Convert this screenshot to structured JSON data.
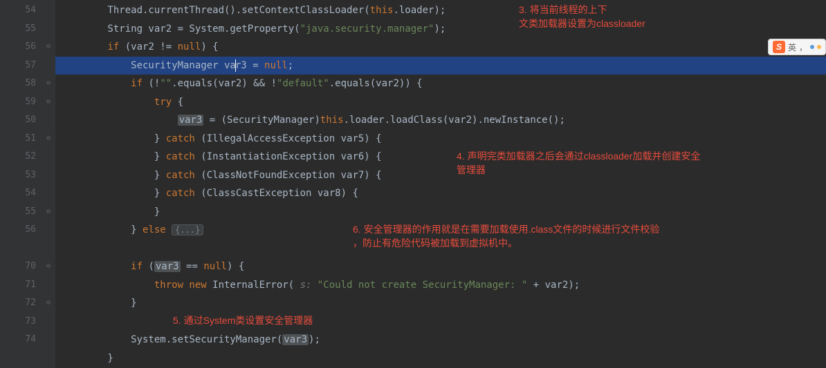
{
  "lineNumbers": [
    "54",
    "55",
    "56",
    "57",
    "58",
    "59",
    "50",
    "51",
    "52",
    "53",
    "54",
    "55",
    "56",
    "",
    "70",
    "71",
    "72",
    "73",
    "74"
  ],
  "foldMarks": [
    "",
    "",
    "⊖",
    "",
    "⊖",
    "⊖",
    "",
    "⊖",
    "",
    "",
    "",
    "⊖",
    "",
    "",
    "⊖",
    "",
    "⊖",
    "",
    ""
  ],
  "code": {
    "l54_pre": "        Thread.currentThread().setContextClassLoader(",
    "l54_this": "this",
    "l54_post": ".loader);",
    "l55_pre": "        String var2 = System.getProperty(",
    "l55_str": "\"java.security.manager\"",
    "l55_post": ");",
    "l56_if": "        if",
    "l56_cond": " (var2 != ",
    "l56_null": "null",
    "l56_post": ") {",
    "l57_pre": "            SecurityManager va",
    "l57_r3": "r3 = ",
    "l57_null": "null",
    "l57_post": ";",
    "l58_if": "            if",
    "l58_p1": " (!",
    "l58_s1": "\"\"",
    "l58_p2": ".equals(var2) && !",
    "l58_s2": "\"default\"",
    "l58_p3": ".equals(var2)) {",
    "l59_try": "                try",
    "l59_post": " {",
    "l60_pre": "                    ",
    "l60_var3": "var3",
    "l60_p1": " = (SecurityManager)",
    "l60_this": "this",
    "l60_p2": ".loader.loadClass(var2).newInstance();",
    "l61_pre": "                } ",
    "l61_catch": "catch",
    "l61_post": " (IllegalAccessException var5) {",
    "l62_pre": "                } ",
    "l62_catch": "catch",
    "l62_post": " (InstantiationException var6) {",
    "l63_pre": "                } ",
    "l63_catch": "catch",
    "l63_post": " (ClassNotFoundException var7) {",
    "l64_pre": "                } ",
    "l64_catch": "catch",
    "l64_post": " (ClassCastException var8) {",
    "l65": "                }",
    "l66_pre": "            } ",
    "l66_else": "else",
    "l66_sp": " ",
    "l66_fold": "{...}",
    "l70_if": "            if",
    "l70_p1": " (",
    "l70_var3": "var3",
    "l70_p2": " == ",
    "l70_null": "null",
    "l70_post": ") {",
    "l71_pre": "                ",
    "l71_throw": "throw new",
    "l71_p1": " InternalError(",
    "l71_hint": " s: ",
    "l71_str": "\"Could not create SecurityManager: \"",
    "l71_p2": " + var2);",
    "l72": "            }",
    "l74_pre": "            System.setSecurityManager(",
    "l74_var3": "var3",
    "l74_post": ");",
    "l75": "        }"
  },
  "annotations": {
    "a3_l1": "3. 将当前线程的上下",
    "a3_l2": "文类加载器设置为classloader",
    "a4_l1": "4. 声明完类加载器之后会通过classloader加载并创建安全",
    "a4_l2": "管理器",
    "a5": "5. 通过System类设置安全管理器",
    "a6_l1": "6. 安全管理器的作用就是在需要加载使用.class文件的时候进行文件校验",
    "a6_l2": "，防止有危险代码被加载到虚拟机中。"
  },
  "ime": {
    "icon": "S",
    "lang": "英",
    "punct": "，"
  }
}
